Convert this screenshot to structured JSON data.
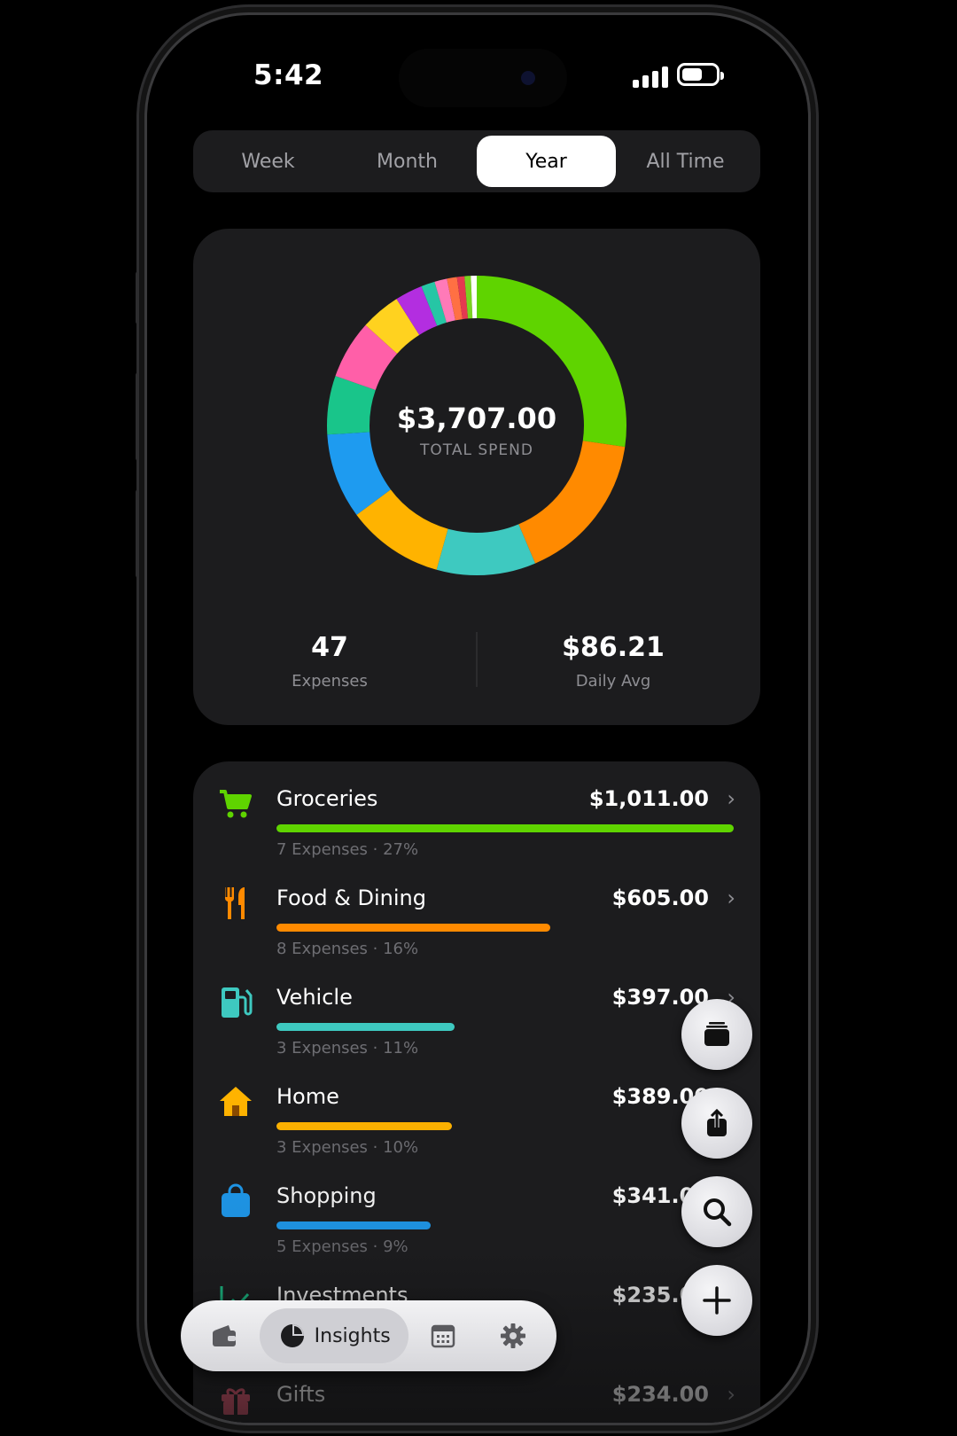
{
  "status_bar": {
    "time": "5:42"
  },
  "period_selector": {
    "options": [
      "Week",
      "Month",
      "Year",
      "All Time"
    ],
    "selected": "Year"
  },
  "summary": {
    "total": "$3,707.00",
    "total_label": "TOTAL SPEND",
    "expenses_count": "47",
    "expenses_label": "Expenses",
    "daily_avg": "$86.21",
    "daily_avg_label": "Daily Avg"
  },
  "chart_data": {
    "type": "pie",
    "title": "",
    "values": [
      1011,
      605,
      397,
      389,
      341,
      235,
      234,
      160,
      110,
      55,
      50,
      40,
      30,
      25,
      25
    ],
    "colors": [
      "#5fd400",
      "#ff8a00",
      "#3ec9c0",
      "#ffb300",
      "#1e9bf0",
      "#19c58a",
      "#ff5fa8",
      "#ffd21f",
      "#b32ee0",
      "#26c6a5",
      "#ff7ab8",
      "#ff7043",
      "#e53950",
      "#7ad321",
      "#ffffff"
    ]
  },
  "categories": [
    {
      "name": "Groceries",
      "amount": "$1,011.00",
      "subtitle": "7 Expenses · 27%",
      "fraction": 1.0,
      "color": "#5fd400",
      "icon": "cart-icon"
    },
    {
      "name": "Food & Dining",
      "amount": "$605.00",
      "subtitle": "8 Expenses · 16%",
      "fraction": 0.598,
      "color": "#ff8a00",
      "icon": "fork-knife-icon"
    },
    {
      "name": "Vehicle",
      "amount": "$397.00",
      "subtitle": "3 Expenses · 11%",
      "fraction": 0.39,
      "color": "#3ec9c0",
      "icon": "fuel-pump-icon"
    },
    {
      "name": "Home",
      "amount": "$389.00",
      "subtitle": "3 Expenses · 10%",
      "fraction": 0.384,
      "color": "#ffb300",
      "icon": "house-icon"
    },
    {
      "name": "Shopping",
      "amount": "$341.00",
      "subtitle": "5 Expenses · 9%",
      "fraction": 0.337,
      "color": "#1e9bf0",
      "icon": "shopping-bag-icon"
    },
    {
      "name": "Investments",
      "amount": "$235.00",
      "subtitle": "",
      "fraction": 0.232,
      "color": "#19c58a",
      "icon": "trend-chart-icon"
    },
    {
      "name": "Gifts",
      "amount": "$234.00",
      "subtitle": "",
      "fraction": 0.231,
      "color": "#e0556e",
      "icon": "gift-icon"
    }
  ],
  "tab_bar": {
    "items": [
      "wallet-icon",
      "pie-chart-icon",
      "calendar-icon",
      "gear-icon"
    ],
    "active_label": "Insights"
  },
  "floating_actions": [
    "stack-icon",
    "share-icon",
    "search-icon",
    "plus-icon"
  ]
}
